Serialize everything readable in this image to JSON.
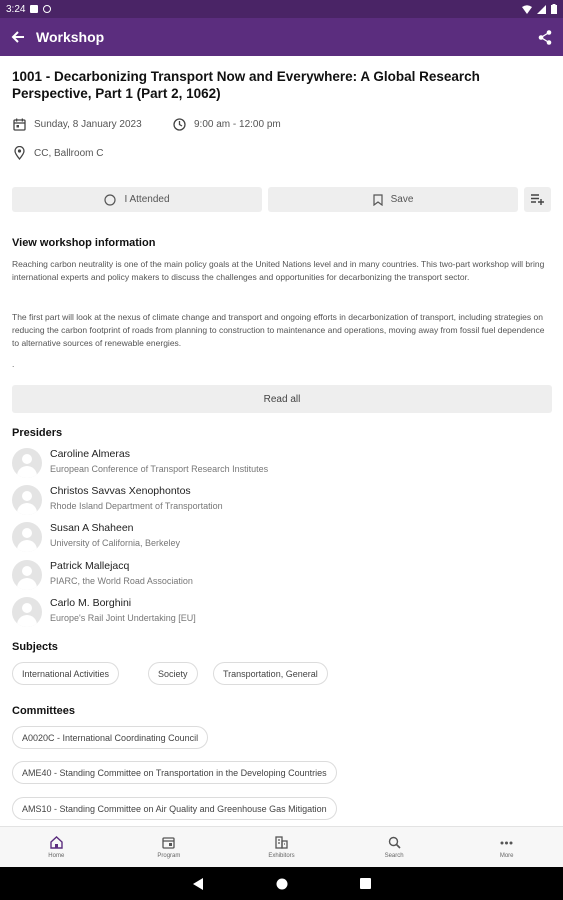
{
  "status_bar": {
    "time": "3:24"
  },
  "app_bar": {
    "title": "Workshop"
  },
  "event": {
    "title": "1001 - Decarbonizing Transport Now and Everywhere: A Global Research Perspective, Part 1 (Part 2, 1062)",
    "date": "Sunday, 8 January 2023",
    "time": "9:00 am - 12:00 pm",
    "location": "CC, Ballroom C"
  },
  "actions": {
    "attended_label": "I Attended",
    "save_label": "Save"
  },
  "info": {
    "heading": "View workshop information",
    "paragraph1": "Reaching carbon neutrality is one of the main policy goals at the United Nations level and in many countries. This two-part workshop will bring international experts and policy makers to discuss the challenges and opportunities for decarbonizing the transport sector.",
    "paragraph2": "The first part will look at the nexus of climate change and transport and ongoing efforts in decarbonization of transport, including strategies on reducing the carbon footprint of roads from planning to construction to maintenance and operations, moving away from fossil fuel dependence to alternative sources of renewable energies.",
    "trailing": ".",
    "read_all_label": "Read all"
  },
  "presiders": {
    "heading": "Presiders",
    "items": [
      {
        "name": "Caroline Almeras",
        "org": "European Conference of Transport Research Institutes"
      },
      {
        "name": "Christos Savvas Xenophontos",
        "org": "Rhode Island Department of Transportation"
      },
      {
        "name": "Susan A Shaheen",
        "org": "University of California, Berkeley"
      },
      {
        "name": "Patrick Mallejacq",
        "org": "PIARC, the World Road Association"
      },
      {
        "name": "Carlo M. Borghini",
        "org": "Europe's Rail Joint Undertaking [EU]"
      }
    ]
  },
  "subjects": {
    "heading": "Subjects",
    "items": [
      "International Activities",
      "Society",
      "Transportation, General"
    ]
  },
  "committees": {
    "heading": "Committees",
    "items": [
      "A0020C - International Coordinating Council",
      "AME40 - Standing Committee on Transportation in the Developing Countries",
      "AMS10 - Standing Committee on Air Quality and Greenhouse Gas Mitigation"
    ]
  },
  "bottom_nav": {
    "items": [
      {
        "label": "Home",
        "icon": "home-icon"
      },
      {
        "label": "Program",
        "icon": "calendar-icon"
      },
      {
        "label": "Exhibitors",
        "icon": "building-icon"
      },
      {
        "label": "Search",
        "icon": "search-icon"
      },
      {
        "label": "More",
        "icon": "more-icon"
      }
    ]
  },
  "colors": {
    "status_bar": "#4a2466",
    "app_bar": "#5b2d7e",
    "button_bg": "#eeeeee"
  }
}
